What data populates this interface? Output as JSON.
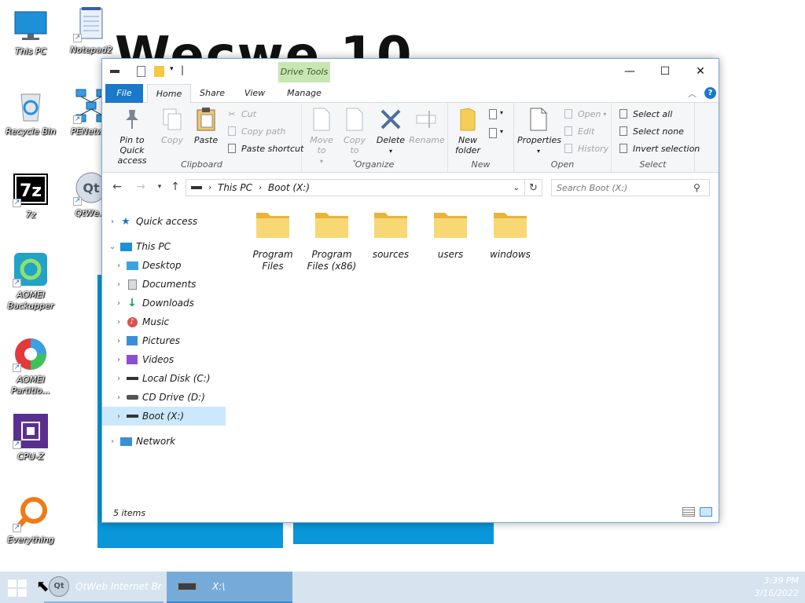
{
  "desktop": {
    "wallpaper_title": "Wecwe 10",
    "icons": [
      {
        "label": "This PC",
        "icon": "monitor-icon"
      },
      {
        "label": "Notepad2",
        "icon": "notepad-icon"
      },
      {
        "label": "Recycle Bin",
        "icon": "recycle-bin-icon"
      },
      {
        "label": "PENetw...",
        "icon": "network-diagram-icon"
      },
      {
        "label": "7z",
        "icon": "7zip-icon"
      },
      {
        "label": "QtWe...",
        "icon": "qt-icon"
      },
      {
        "label": "AOMEI Backupper",
        "icon": "backupper-icon"
      },
      {
        "label": "AOMEI Partitio...",
        "icon": "partition-icon"
      },
      {
        "label": "CPU-Z",
        "icon": "cpu-icon"
      },
      {
        "label": "Everything",
        "icon": "magnifier-icon"
      }
    ]
  },
  "window": {
    "title_path": "|",
    "contextual_tab": "Drive Tools",
    "controls": {
      "minimize": "—",
      "maximize": "☐",
      "close": "✕"
    }
  },
  "ribbon": {
    "tabs": [
      "File",
      "Home",
      "Share",
      "View",
      "Manage"
    ],
    "groups": {
      "clipboard": {
        "name": "Clipboard",
        "pin": "Pin to Quick access",
        "copy": "Copy",
        "paste": "Paste",
        "cut": "Cut",
        "copy_path": "Copy path",
        "paste_shortcut": "Paste shortcut"
      },
      "organize": {
        "name": "Organize",
        "move_to": "Move to",
        "copy_to": "Copy to",
        "delete": "Delete",
        "rename": "Rename"
      },
      "new": {
        "name": "New",
        "new_folder": "New folder"
      },
      "open": {
        "name": "Open",
        "properties": "Properties",
        "open": "Open",
        "edit": "Edit",
        "history": "History"
      },
      "select": {
        "name": "Select",
        "select_all": "Select all",
        "select_none": "Select none",
        "invert": "Invert selection"
      }
    }
  },
  "address": {
    "crumbs": [
      "This PC",
      "Boot (X:)"
    ],
    "search_placeholder": "Search Boot (X:)"
  },
  "nav": {
    "quick_access": "Quick access",
    "this_pc": "This PC",
    "items": [
      "Desktop",
      "Documents",
      "Downloads",
      "Music",
      "Pictures",
      "Videos",
      "Local Disk (C:)",
      "CD Drive (D:)",
      "Boot (X:)"
    ],
    "network": "Network"
  },
  "folders": [
    {
      "line1": "Program",
      "line2": "Files"
    },
    {
      "line1": "Program",
      "line2": "Files (x86)"
    },
    {
      "line1": "sources",
      "line2": ""
    },
    {
      "line1": "users",
      "line2": ""
    },
    {
      "line1": "windows",
      "line2": ""
    }
  ],
  "status": {
    "count": "5 items"
  },
  "taskbar": {
    "apps": [
      {
        "label": "QtWeb Internet Br...",
        "icon": "qt-icon"
      },
      {
        "label": "X:\\",
        "icon": "drive-icon"
      }
    ],
    "time": "3:39 PM",
    "date": "3/16/2022"
  }
}
